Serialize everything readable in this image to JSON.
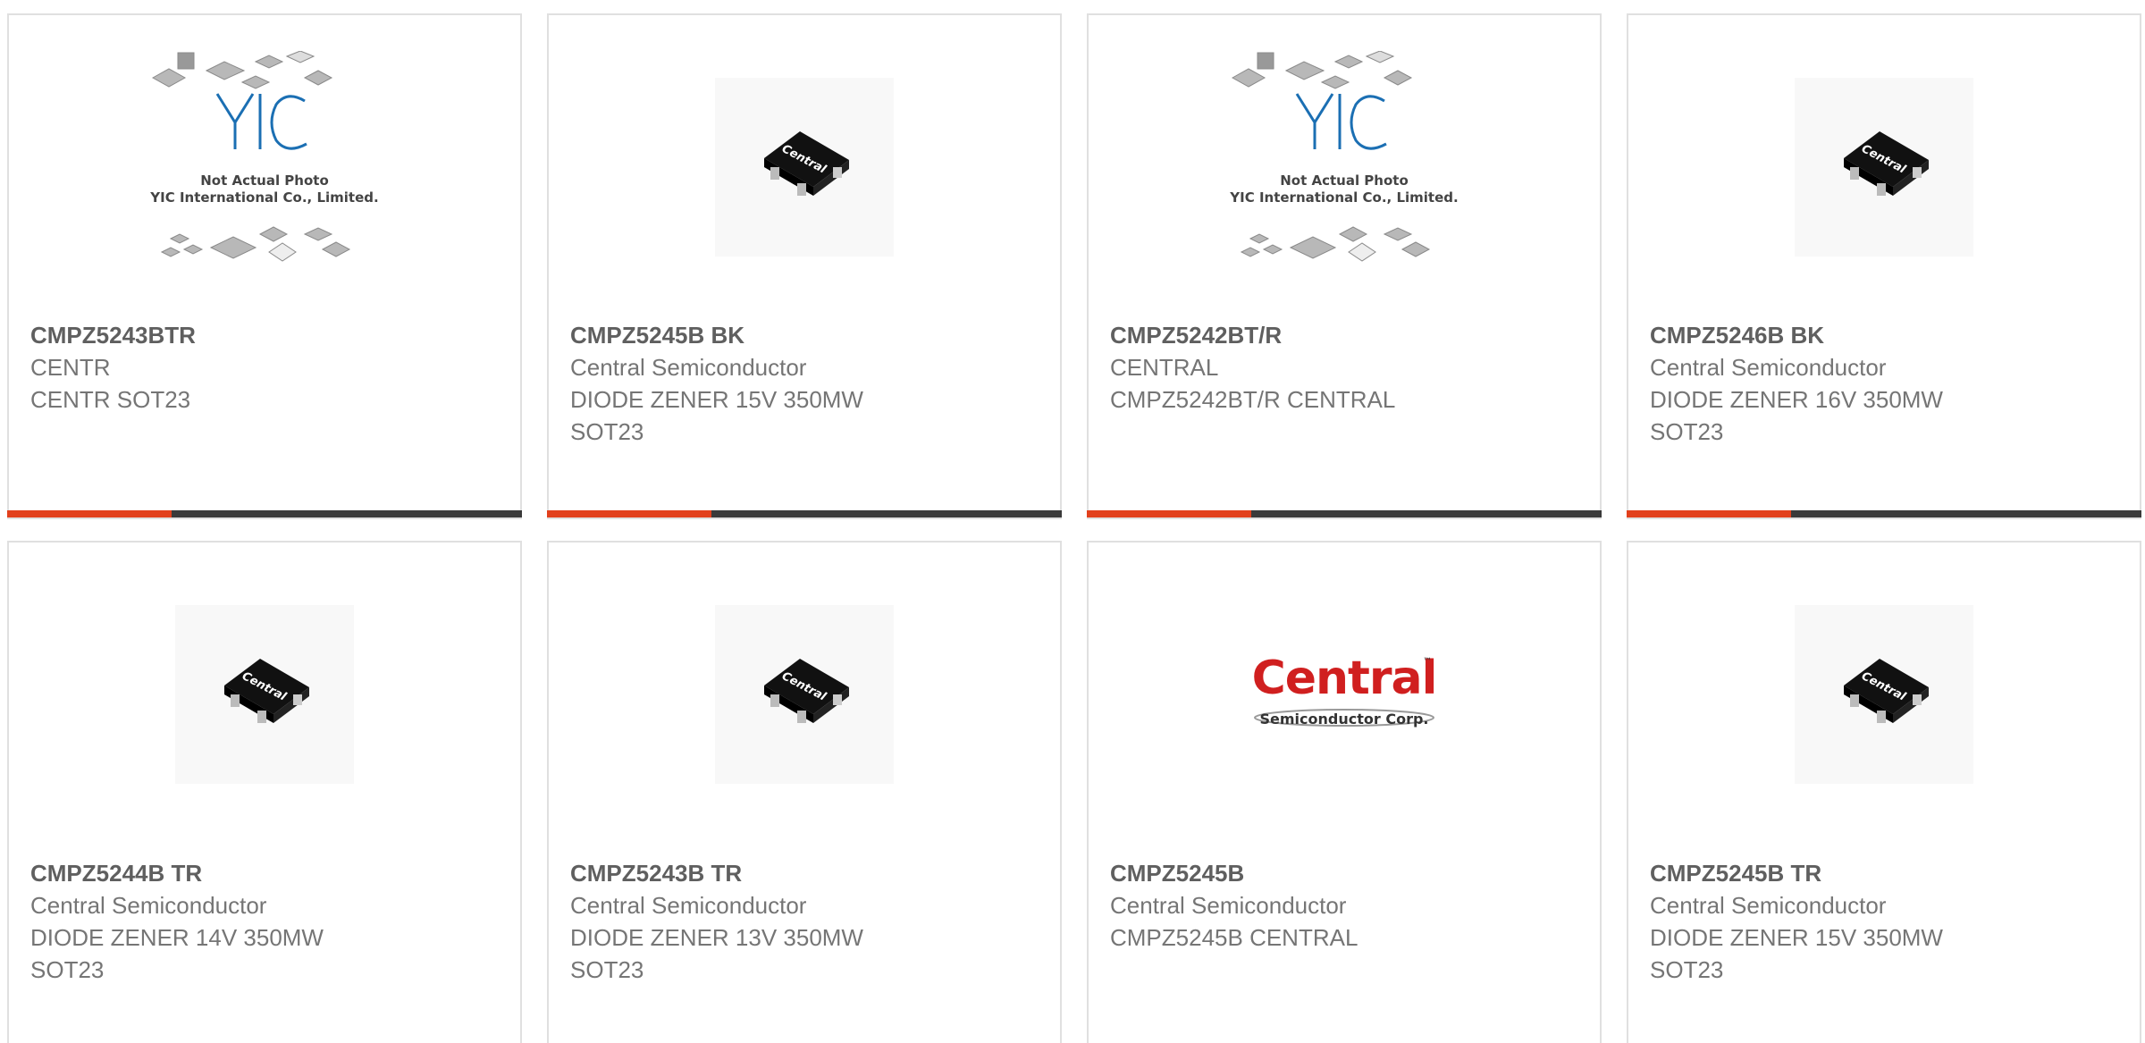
{
  "products": [
    {
      "part_number": "CMPZ5243BTR",
      "manufacturer": "CENTR",
      "description": "CENTR SOT23",
      "image": "yic-placeholder"
    },
    {
      "part_number": "CMPZ5245B BK",
      "manufacturer": "Central Semiconductor",
      "description": "DIODE ZENER 15V 350MW SOT23",
      "image": "sot23-photo"
    },
    {
      "part_number": "CMPZ5242BT/R",
      "manufacturer": "CENTRAL",
      "description": "CMPZ5242BT/R CENTRAL",
      "image": "yic-placeholder"
    },
    {
      "part_number": "CMPZ5246B BK",
      "manufacturer": "Central Semiconductor",
      "description": "DIODE ZENER 16V 350MW SOT23",
      "image": "sot23-photo"
    },
    {
      "part_number": "CMPZ5244B TR",
      "manufacturer": "Central Semiconductor",
      "description": "DIODE ZENER 14V 350MW SOT23",
      "image": "sot23-photo"
    },
    {
      "part_number": "CMPZ5243B TR",
      "manufacturer": "Central Semiconductor",
      "description": "DIODE ZENER 13V 350MW SOT23",
      "image": "sot23-photo"
    },
    {
      "part_number": "CMPZ5245B",
      "manufacturer": "Central Semiconductor",
      "description": "CMPZ5245B CENTRAL",
      "image": "central-logo"
    },
    {
      "part_number": "CMPZ5245B TR",
      "manufacturer": "Central Semiconductor",
      "description": "DIODE ZENER 15V 350MW SOT23",
      "image": "sot23-photo"
    }
  ],
  "placeholder": {
    "brand": "YIC",
    "line1": "Not Actual Photo",
    "line2": "YIC International Co., Limited."
  },
  "chip_marking": "Central",
  "logo": {
    "word": "Central",
    "tagline": "Semiconductor Corp.",
    "tm": "™"
  },
  "colors": {
    "accent": "#e2401c",
    "bar": "#3a3a3a",
    "brand_red": "#d01f1f",
    "yic_blue": "#1b6fb3"
  }
}
